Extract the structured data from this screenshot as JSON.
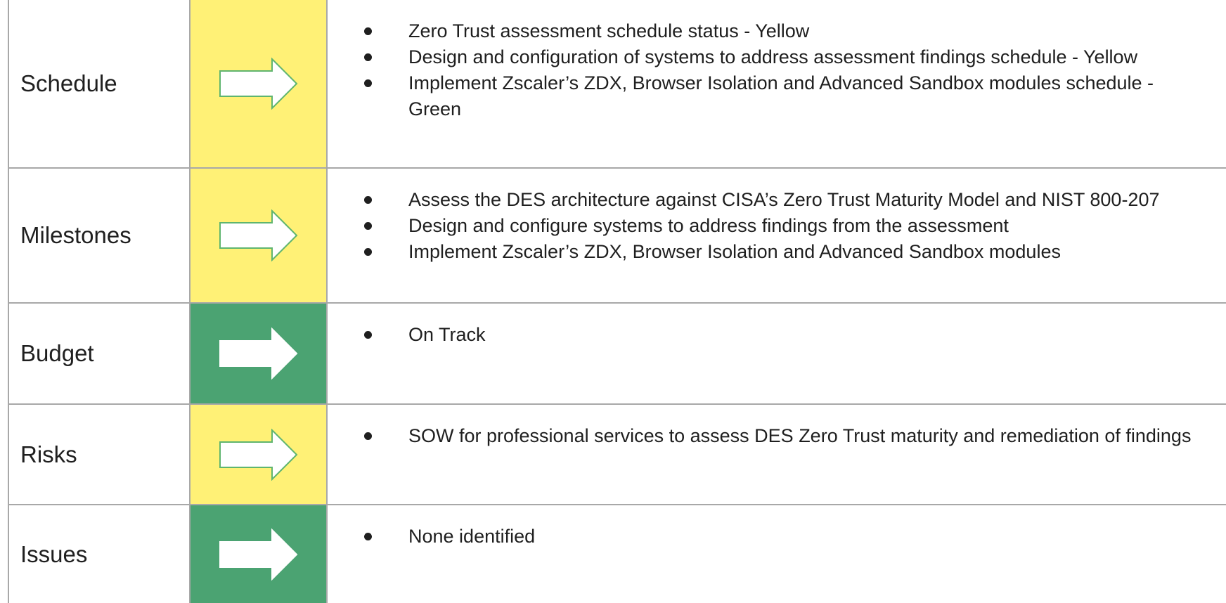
{
  "colors": {
    "yellow": "#fff176",
    "green": "#4ba372",
    "arrow_outline": "#5fb56f",
    "grid_line": "#a8a8a8"
  },
  "rows": [
    {
      "label": "Schedule",
      "status": "yellow",
      "items": [
        "Zero Trust assessment schedule status - Yellow",
        "Design and configuration of systems to address assessment findings schedule - Yellow",
        "Implement Zscaler’s ZDX, Browser Isolation and Advanced Sandbox modules schedule - Green"
      ]
    },
    {
      "label": "Milestones",
      "status": "yellow",
      "items": [
        "Assess the DES architecture against CISA’s Zero Trust Maturity Model and  NIST 800-207",
        "Design and configure systems to address findings from the assessment",
        "Implement Zscaler’s ZDX, Browser Isolation and Advanced Sandbox modules"
      ]
    },
    {
      "label": "Budget",
      "status": "green",
      "items": [
        "On Track"
      ]
    },
    {
      "label": "Risks",
      "status": "yellow",
      "items": [
        "SOW for professional services to assess DES Zero Trust maturity and remediation of findings"
      ]
    },
    {
      "label": "Issues",
      "status": "green",
      "items": [
        "None identified"
      ]
    }
  ]
}
